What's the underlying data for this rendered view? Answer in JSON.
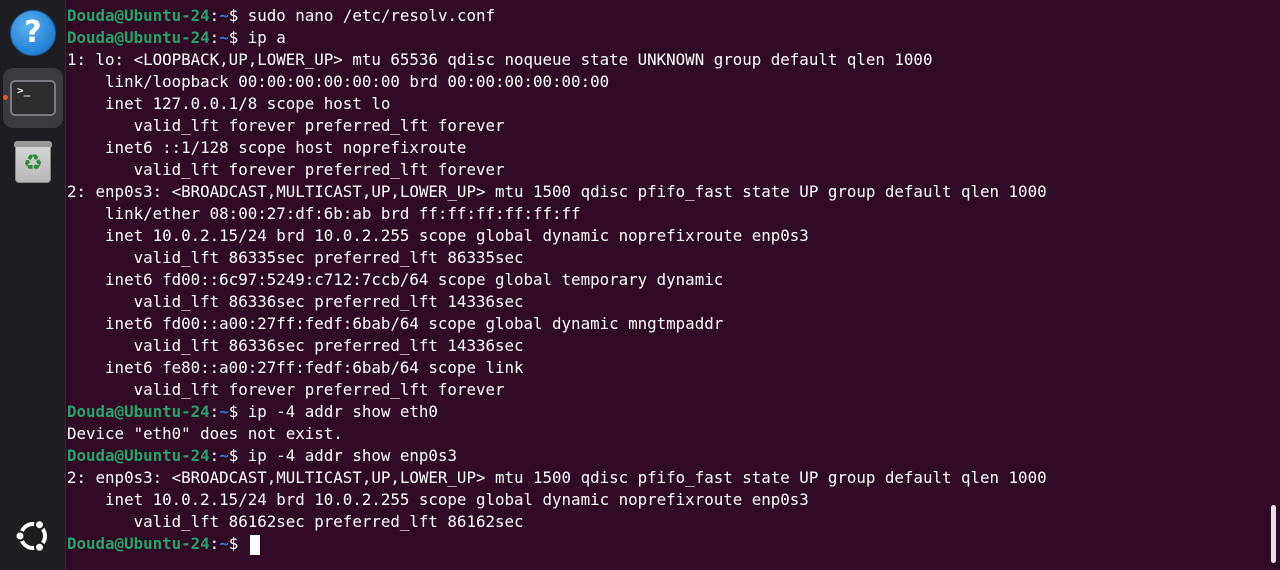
{
  "dock": {
    "items": [
      {
        "name": "help",
        "icon": "help-icon",
        "glyph": "?"
      },
      {
        "name": "terminal",
        "icon": "terminal-icon",
        "glyph": ">_",
        "active": true
      },
      {
        "name": "trash",
        "icon": "trash-icon",
        "glyph": "♻"
      },
      {
        "name": "show-apps",
        "icon": "ubuntu-logo-icon"
      }
    ]
  },
  "terminal": {
    "prompt_user": "Douda@Ubuntu-24",
    "prompt_colon": ":",
    "prompt_path": "~",
    "prompt_dollar": "$ ",
    "lines": [
      {
        "type": "prompt",
        "cmd": "sudo nano /etc/resolv.conf"
      },
      {
        "type": "prompt",
        "cmd": "ip a"
      },
      {
        "type": "out",
        "text": "1: lo: <LOOPBACK,UP,LOWER_UP> mtu 65536 qdisc noqueue state UNKNOWN group default qlen 1000"
      },
      {
        "type": "out",
        "text": "    link/loopback 00:00:00:00:00:00 brd 00:00:00:00:00:00"
      },
      {
        "type": "out",
        "text": "    inet 127.0.0.1/8 scope host lo"
      },
      {
        "type": "out",
        "text": "       valid_lft forever preferred_lft forever"
      },
      {
        "type": "out",
        "text": "    inet6 ::1/128 scope host noprefixroute"
      },
      {
        "type": "out",
        "text": "       valid_lft forever preferred_lft forever"
      },
      {
        "type": "out",
        "text": "2: enp0s3: <BROADCAST,MULTICAST,UP,LOWER_UP> mtu 1500 qdisc pfifo_fast state UP group default qlen 1000"
      },
      {
        "type": "out",
        "text": "    link/ether 08:00:27:df:6b:ab brd ff:ff:ff:ff:ff:ff"
      },
      {
        "type": "out",
        "text": "    inet 10.0.2.15/24 brd 10.0.2.255 scope global dynamic noprefixroute enp0s3"
      },
      {
        "type": "out",
        "text": "       valid_lft 86335sec preferred_lft 86335sec"
      },
      {
        "type": "out",
        "text": "    inet6 fd00::6c97:5249:c712:7ccb/64 scope global temporary dynamic"
      },
      {
        "type": "out",
        "text": "       valid_lft 86336sec preferred_lft 14336sec"
      },
      {
        "type": "out",
        "text": "    inet6 fd00::a00:27ff:fedf:6bab/64 scope global dynamic mngtmpaddr"
      },
      {
        "type": "out",
        "text": "       valid_lft 86336sec preferred_lft 14336sec"
      },
      {
        "type": "out",
        "text": "    inet6 fe80::a00:27ff:fedf:6bab/64 scope link"
      },
      {
        "type": "out",
        "text": "       valid_lft forever preferred_lft forever"
      },
      {
        "type": "prompt",
        "cmd": "ip -4 addr show eth0"
      },
      {
        "type": "out",
        "text": "Device \"eth0\" does not exist."
      },
      {
        "type": "prompt",
        "cmd": "ip -4 addr show enp0s3"
      },
      {
        "type": "out",
        "text": "2: enp0s3: <BROADCAST,MULTICAST,UP,LOWER_UP> mtu 1500 qdisc pfifo_fast state UP group default qlen 1000"
      },
      {
        "type": "out",
        "text": "    inet 10.0.2.15/24 brd 10.0.2.255 scope global dynamic noprefixroute enp0s3"
      },
      {
        "type": "out",
        "text": "       valid_lft 86162sec preferred_lft 86162sec"
      },
      {
        "type": "prompt",
        "cmd": ""
      }
    ]
  },
  "colors": {
    "background": "#300a24",
    "prompt_user": "#26a269",
    "prompt_path": "#2a7bd6",
    "text": "#ffffff",
    "accent": "#e95420"
  }
}
